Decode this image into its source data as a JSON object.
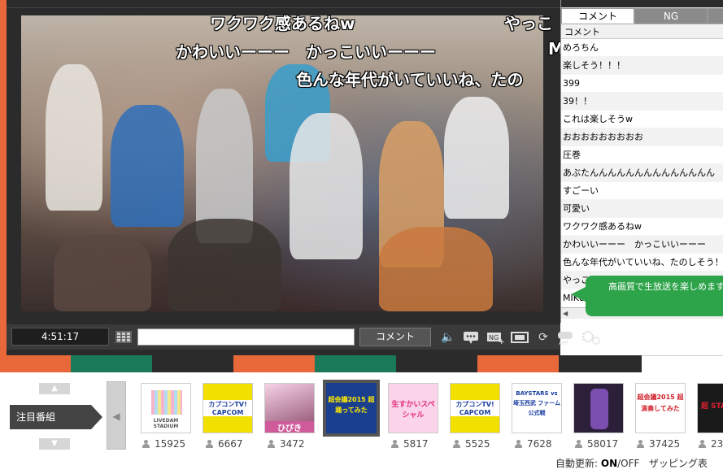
{
  "player": {
    "overlay_comments": [
      "ワクワク感あるねw",
      "やっこ",
      "かわいいーーー　かっこいいーーー",
      "M",
      "色んな年代がいていいね、たの"
    ],
    "time": "4:51:17",
    "comment_button": "コメント",
    "comment_placeholder": "",
    "colors": {
      "frame": "#2b2b2b",
      "orange": "#e8683a",
      "teal": "#1a7a5a"
    }
  },
  "panel": {
    "tabs": [
      "コメント",
      "NG"
    ],
    "column_header": "コメント",
    "comments": [
      "めろちん",
      "楽しそう！！！",
      "399",
      "39！！",
      "これは楽しそうw",
      "おおおおおおおおお",
      "圧巻",
      "あぶたんんんんんんんんんんんんんん",
      "すごーい",
      "可愛い",
      "ワクワク感あるねw",
      "かわいいーーー　かっこいいーーー",
      "色んな年代がいていいね、たのしそう！",
      "やっこ",
      "MIKU"
    ],
    "tooltip": "高画質で生放送を楽しめます"
  },
  "bottom": {
    "attention_label": "注目番組",
    "programs": [
      {
        "thumb_text": "LIVEDAM STADIUM",
        "viewers": "15925",
        "icon": "livedam-thumb"
      },
      {
        "thumb_text": "カプコンTV! CAPCOM",
        "viewers": "6667",
        "icon": "capcom-thumb"
      },
      {
        "thumb_text": "ひびき",
        "viewers": "3472",
        "icon": "idol-thumb"
      },
      {
        "thumb_text": "超会議2015 超踊ってみた",
        "viewers": "",
        "icon": "chokaigi-dance-thumb"
      },
      {
        "thumb_text": "生すかいスペシャル",
        "viewers": "5817",
        "icon": "pink-thumb"
      },
      {
        "thumb_text": "カプコンTV! CAPCOM",
        "viewers": "5525",
        "icon": "capcom-thumb"
      },
      {
        "thumb_text": "BAYSTARS vs 埼玉西武 ファーム公式戦",
        "viewers": "7628",
        "icon": "baseball-thumb"
      },
      {
        "thumb_text": "",
        "viewers": "58017",
        "icon": "character-thumb"
      },
      {
        "thumb_text": "超会議2015 超演奏してみた",
        "viewers": "37425",
        "icon": "chokaigi-play-thumb"
      },
      {
        "thumb_text": "超 STA",
        "viewers": "23",
        "icon": "partial-thumb"
      }
    ],
    "auto_update_label": "自動更新:",
    "auto_update_on": "ON",
    "auto_update_off": "/OFF",
    "zapping": "ザッピング表"
  }
}
